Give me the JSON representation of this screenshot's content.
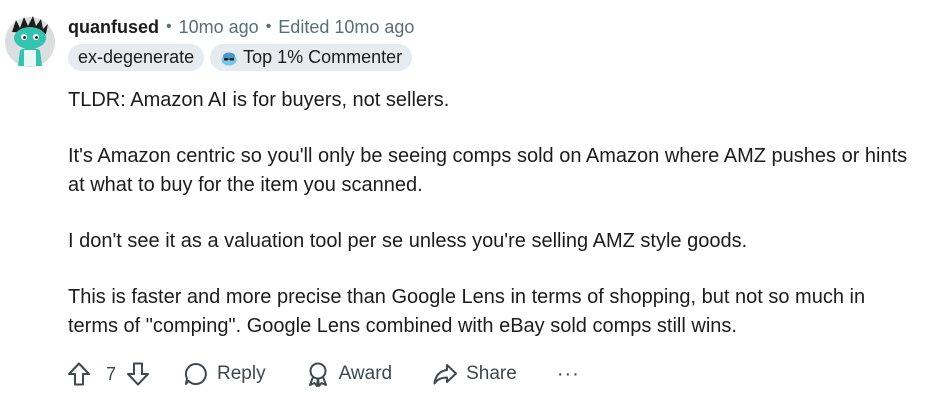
{
  "comment": {
    "author": "quanfused",
    "separator": "•",
    "time": "10mo ago",
    "edited": "Edited 10mo ago",
    "flairs": [
      "ex-degenerate",
      "Top 1% Commenter"
    ],
    "paragraphs": [
      "TLDR: Amazon AI is for buyers, not sellers.",
      "It's Amazon centric so you'll only be seeing comps sold on Amazon where AMZ pushes or hints at what to buy for the item you scanned.",
      "I don't see it as a valuation tool per se unless you're selling AMZ style goods.",
      "This is faster and more precise than Google Lens in terms of shopping, but not so much in terms of \"comping\". Google Lens combined with eBay sold comps still wins."
    ]
  },
  "actions": {
    "vote_count": "7",
    "reply_label": "Reply",
    "award_label": "Award",
    "share_label": "Share",
    "more_label": "···"
  },
  "icons": {
    "upvote": "arrow-up-icon",
    "downvote": "arrow-down-icon",
    "reply": "speech-bubble-icon",
    "award": "award-ribbon-icon",
    "share": "share-arrow-icon",
    "commenter": "top-commenter-icon"
  },
  "colors": {
    "text": "#1c1c1c",
    "muted": "#576f76",
    "flair_bg": "#e5ebee",
    "avatar_accent": "#35c3b0"
  }
}
